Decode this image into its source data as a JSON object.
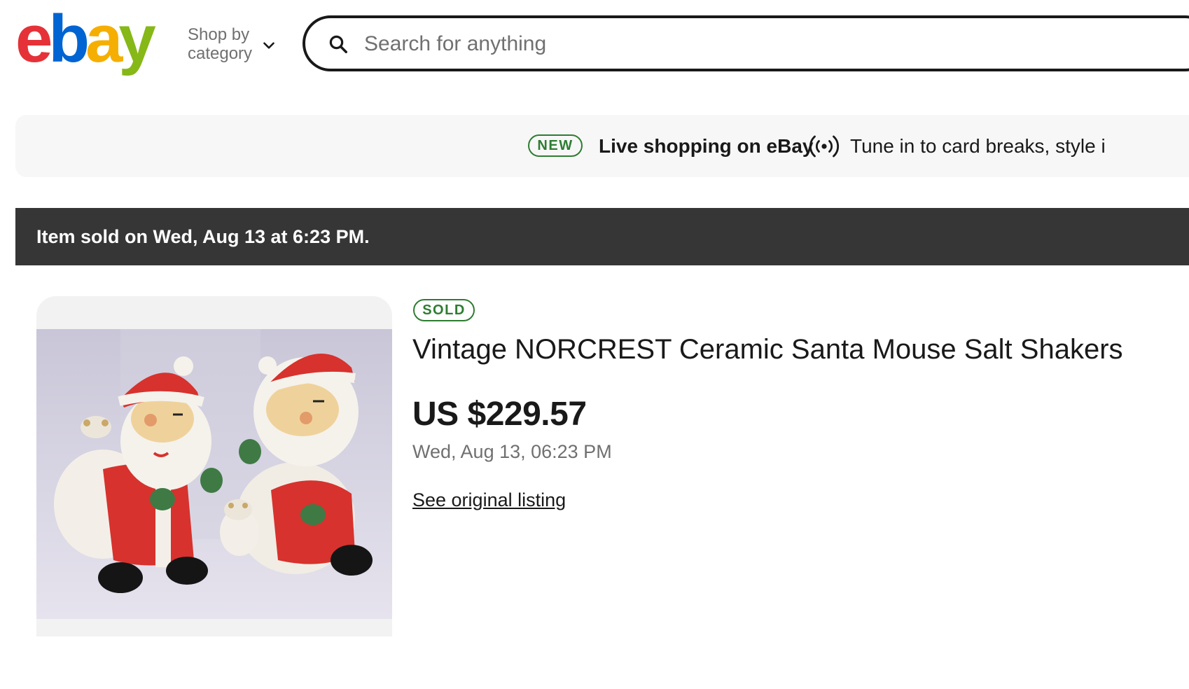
{
  "header": {
    "logo": {
      "e": "e",
      "b": "b",
      "a": "a",
      "y": "y"
    },
    "shop_by_category": "Shop by category",
    "search_placeholder": "Search for anything"
  },
  "promo": {
    "badge": "NEW",
    "title": "Live shopping on eBay",
    "subtitle": "Tune in to card breaks, style i"
  },
  "notice": {
    "text": "Item sold on Wed, Aug 13 at 6:23 PM."
  },
  "item": {
    "status_badge": "SOLD",
    "title": "Vintage NORCREST Ceramic Santa Mouse Salt Shakers",
    "price": "US $229.57",
    "sold_date": "Wed, Aug 13, 06:23 PM",
    "original_listing_link": "See original listing"
  },
  "colors": {
    "logo_red": "#e53238",
    "logo_blue": "#0064d2",
    "logo_yellow": "#f5af02",
    "logo_green": "#86b817",
    "notice_bar": "#363636",
    "badge_green": "#2e7d32",
    "muted_text": "#707070"
  },
  "icons": [
    "search-icon",
    "chevron-down-icon",
    "live-broadcast-icon"
  ]
}
